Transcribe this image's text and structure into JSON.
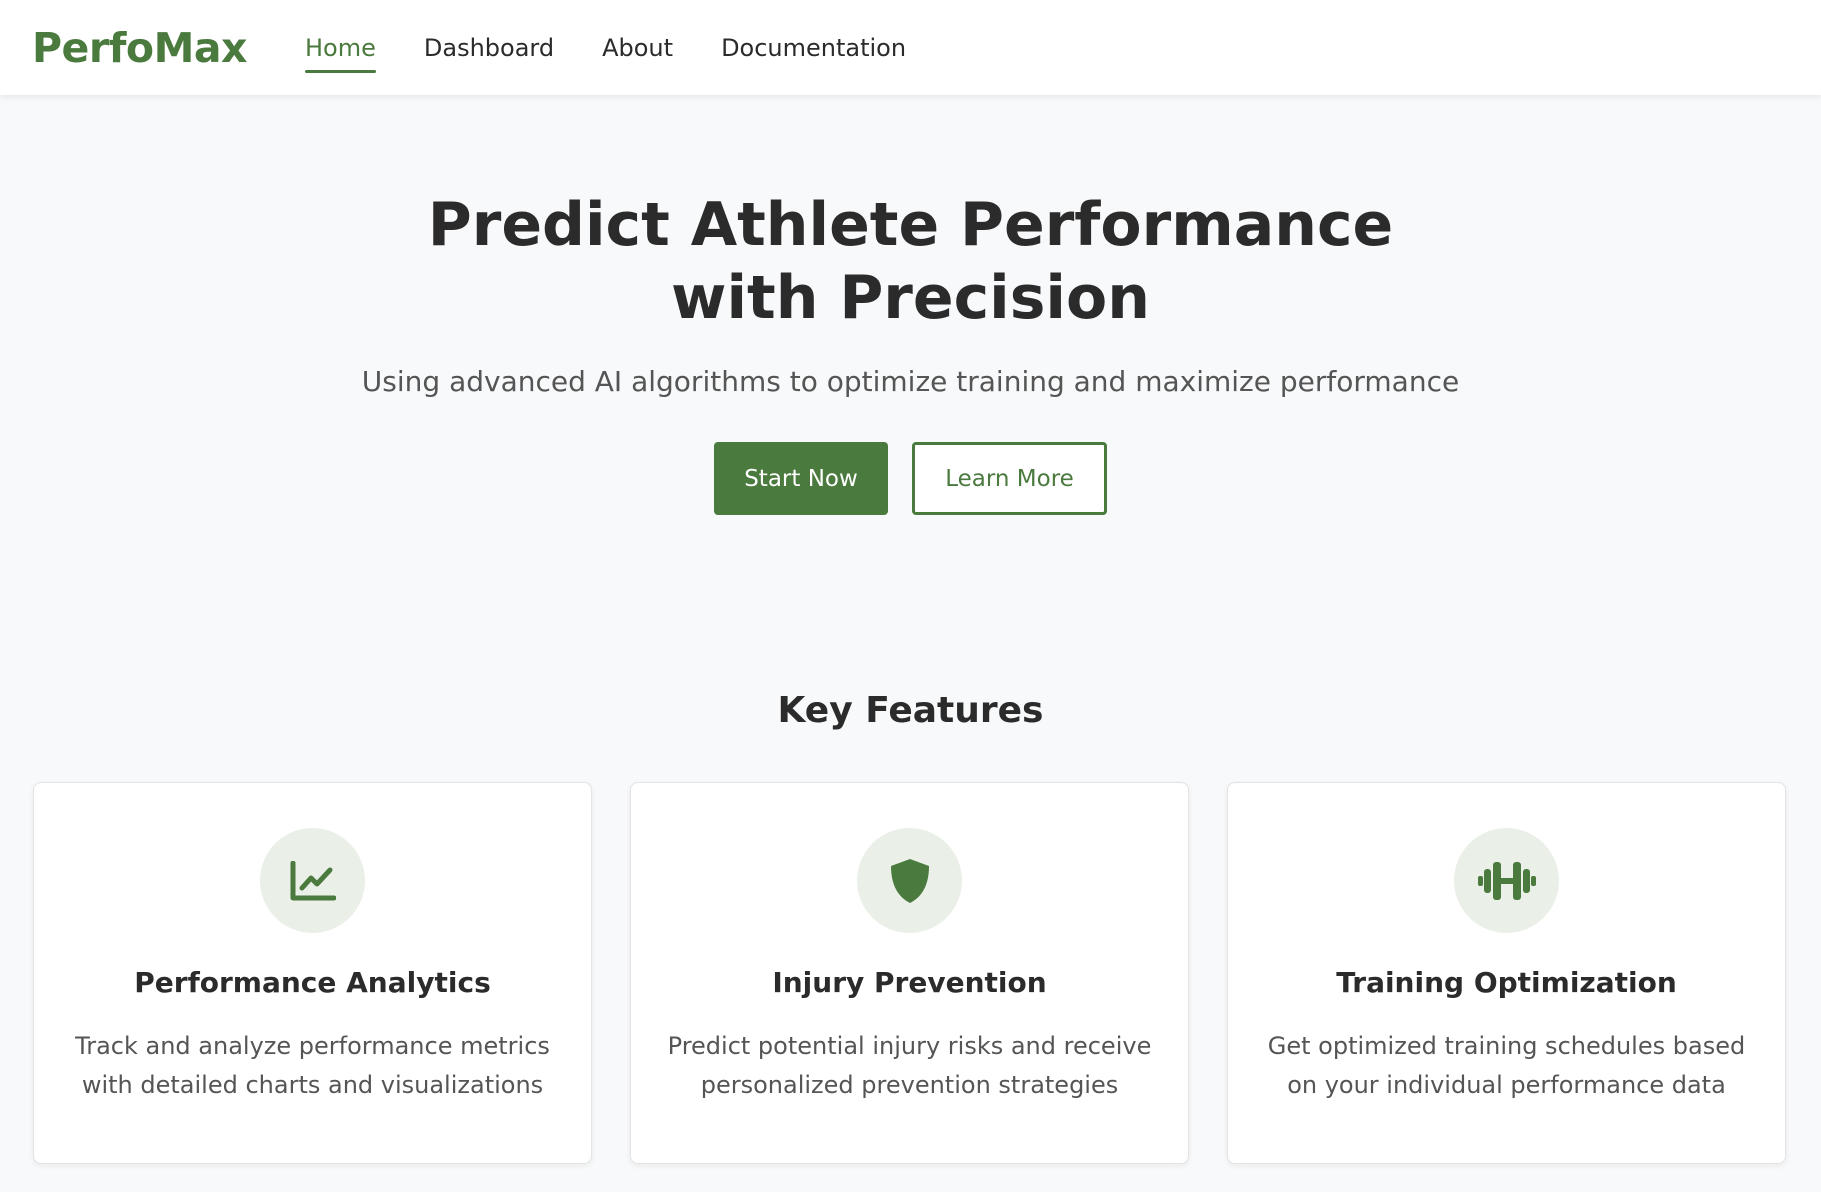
{
  "brand": {
    "name": "PerfoMax"
  },
  "nav": {
    "items": [
      {
        "label": "Home",
        "active": true
      },
      {
        "label": "Dashboard",
        "active": false
      },
      {
        "label": "About",
        "active": false
      },
      {
        "label": "Documentation",
        "active": false
      }
    ]
  },
  "hero": {
    "title": "Predict Athlete Performance with Precision",
    "subtitle": "Using advanced AI algorithms to optimize training and maximize performance",
    "primary_button": "Start Now",
    "secondary_button": "Learn More"
  },
  "features": {
    "heading": "Key Features",
    "cards": [
      {
        "icon": "chart-line-icon",
        "title": "Performance Analytics",
        "description": "Track and analyze performance metrics with detailed charts and visualizations"
      },
      {
        "icon": "shield-icon",
        "title": "Injury Prevention",
        "description": "Predict potential injury risks and receive personalized prevention strategies"
      },
      {
        "icon": "dumbbell-icon",
        "title": "Training Optimization",
        "description": "Get optimized training schedules based on your individual performance data"
      }
    ]
  },
  "colors": {
    "accent": "#4a7a3d",
    "icon_bg": "#eaf0e7",
    "page_bg": "#f8f9fa",
    "text": "#2b2b2b",
    "muted_text": "#555555"
  }
}
